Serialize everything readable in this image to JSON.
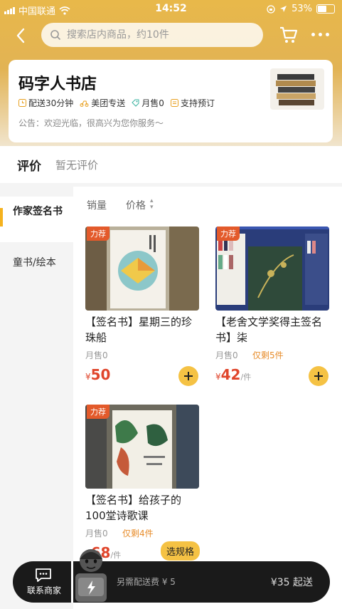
{
  "status_bar": {
    "carrier": "中国联通",
    "time": "14:52",
    "battery": "53%"
  },
  "search": {
    "placeholder": "搜索店内商品，约10件"
  },
  "store": {
    "name": "码字人书店",
    "tags": [
      "配送30分钟",
      "美团专送",
      "月售0",
      "支持预订"
    ],
    "notice": "公告：欢迎光临，很高兴为您你服务～"
  },
  "reviews": {
    "title": "评价",
    "status": "暂无评价"
  },
  "categories": [
    {
      "label": "作家签名书",
      "active": true
    },
    {
      "label": "童书/绘本",
      "active": false
    }
  ],
  "sort": {
    "sales": "销量",
    "price": "价格"
  },
  "products": [
    {
      "badge": "力荐",
      "name": "【签名书】星期三的珍珠船",
      "sold": "月售0",
      "stock": "",
      "price_symbol": "¥",
      "price": "50",
      "unit": ""
    },
    {
      "badge": "力荐",
      "name": "【老舍文学奖得主签名书】柒",
      "sold": "月售0",
      "stock": "仅剩5件",
      "price_symbol": "¥",
      "price": "42",
      "unit": "/件"
    },
    {
      "badge": "力荐",
      "name": "【签名书】给孩子的100堂诗歌课",
      "sold": "月售0",
      "stock": "仅剩4件",
      "price_symbol": "¥",
      "price": "68",
      "unit": "/件",
      "action": "选规格"
    }
  ],
  "bottom_bar": {
    "contact": "联系商家",
    "delivery_fee": "另需配送费 ¥ 5",
    "minimum": "¥35 起送"
  },
  "colors": {
    "accent": "#f5c244",
    "price": "#e0452b",
    "badge": "#e35a2b"
  }
}
